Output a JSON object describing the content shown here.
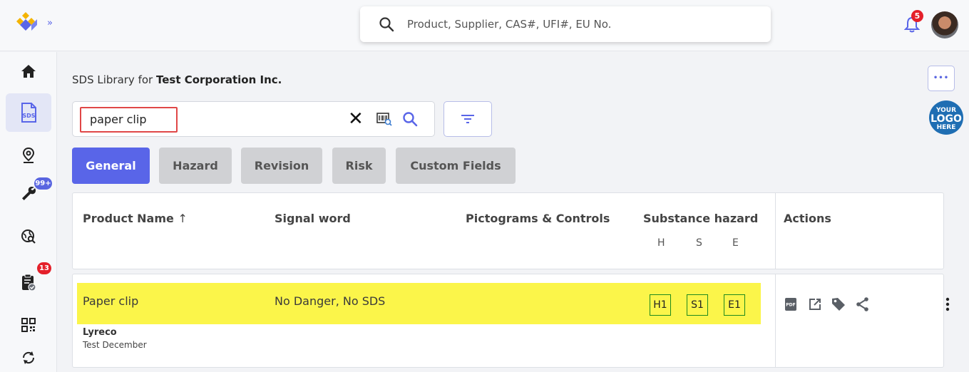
{
  "header": {
    "search_placeholder": "Product, Supplier, CAS#, UFI#, EU No.",
    "notification_count": "5"
  },
  "sidebar": {
    "items": [
      {
        "name": "home",
        "icon": "home-icon"
      },
      {
        "name": "sds",
        "icon": "sds-icon",
        "label": "SDS"
      },
      {
        "name": "location",
        "icon": "location-pin-icon"
      },
      {
        "name": "tools",
        "icon": "wrench-icon",
        "badge": "99+"
      },
      {
        "name": "search-globe",
        "icon": "globe-search-icon"
      },
      {
        "name": "clipboard",
        "icon": "clipboard-check-icon",
        "badge": "13"
      },
      {
        "name": "qr",
        "icon": "qr-code-icon"
      },
      {
        "name": "sync",
        "icon": "sync-icon"
      }
    ]
  },
  "main": {
    "title_prefix": "SDS Library for",
    "title_company": "Test Corporation Inc.",
    "search_value": "paper clip",
    "clear_symbol": "✕",
    "more_label": "•••",
    "logo_badge": {
      "line1": "YOUR",
      "line2": "LOGO",
      "line3": "HERE"
    },
    "tabs": [
      "General",
      "Hazard",
      "Revision",
      "Risk",
      "Custom Fields"
    ],
    "active_tab": "General",
    "columns": {
      "product_name": "Product Name",
      "sort_arrow": "↑",
      "signal_word": "Signal word",
      "pictograms": "Pictograms & Controls",
      "substance_hazard": "Substance hazard",
      "h": "H",
      "s": "S",
      "e": "E",
      "actions": "Actions"
    },
    "rows": [
      {
        "product": "Paper clip",
        "signal_word": "No Danger, No SDS",
        "supplier": "Lyreco",
        "subtitle": "Test December",
        "hazards": [
          "H1",
          "S1",
          "E1"
        ]
      }
    ]
  },
  "colors": {
    "accent": "#5965e8",
    "highlight": "#fbf54a",
    "badge_red": "#e4202a",
    "hazard_border": "#1e8a1e"
  }
}
